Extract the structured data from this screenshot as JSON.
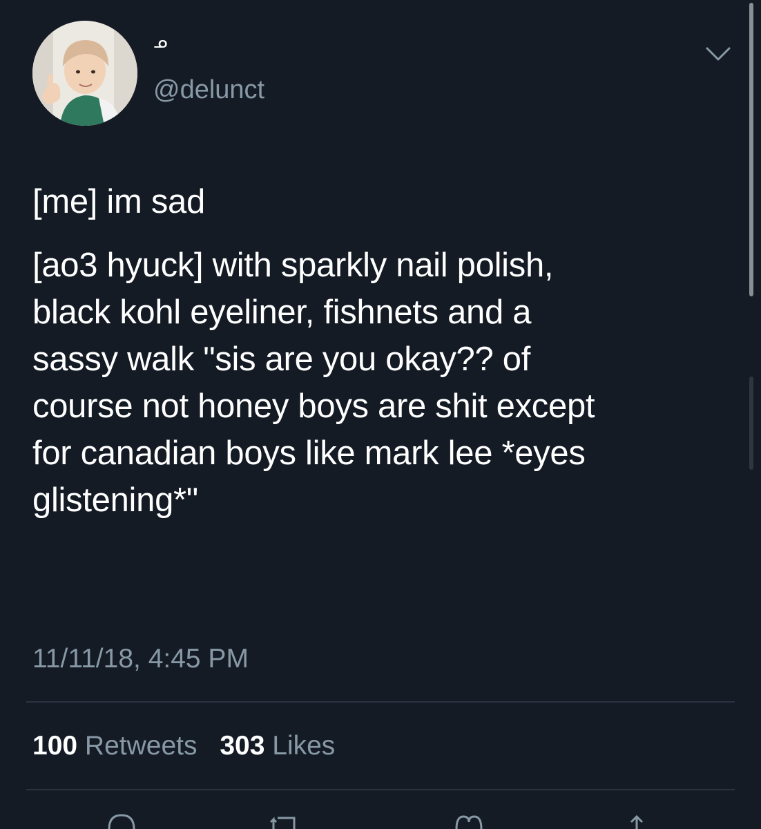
{
  "user": {
    "display_name": "ᓄ",
    "handle": "@delunct",
    "avatar_icon": "avatar-photo"
  },
  "tweet": {
    "paragraphs": [
      [
        "[me] im sad"
      ],
      [
        "[ao3 hyuck] with sparkly nail polish,",
        "black kohl eyeliner, fishnets and a",
        "sassy walk \"sis are you okay?? of",
        "course not honey boys are shit except",
        "for canadian boys like mark lee *eyes",
        "glistening*\""
      ]
    ],
    "timestamp": "11/11/18, 4:45 PM"
  },
  "stats": {
    "retweets_count": "100",
    "retweets_label": "Retweets",
    "likes_count": "303",
    "likes_label": "Likes"
  },
  "actions": [
    {
      "name": "reply-icon"
    },
    {
      "name": "retweet-icon"
    },
    {
      "name": "like-icon"
    },
    {
      "name": "share-icon"
    }
  ],
  "colors": {
    "background": "#141b25",
    "text": "#ffffff",
    "secondary_text": "#8899a6",
    "divider": "#2a3340"
  }
}
